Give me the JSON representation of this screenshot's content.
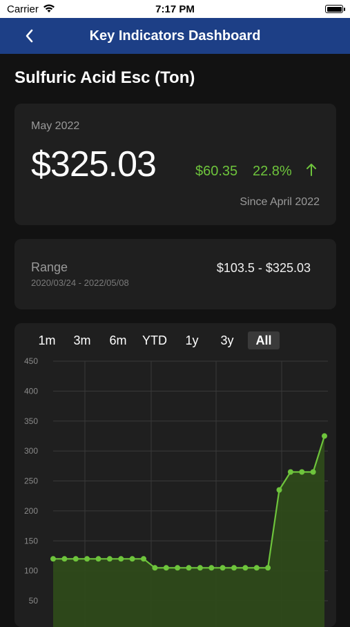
{
  "status_bar": {
    "carrier": "Carrier",
    "time": "7:17 PM"
  },
  "nav": {
    "title": "Key Indicators Dashboard"
  },
  "page": {
    "title": "Sulfuric Acid Esc (Ton)"
  },
  "price": {
    "date": "May 2022",
    "value": "$325.03",
    "change": "$60.35",
    "percent": "22.8%",
    "since": "Since April 2022"
  },
  "range": {
    "label": "Range",
    "dates": "2020/03/24 - 2022/05/08",
    "value": "$103.5 - $325.03"
  },
  "tabs": [
    "1m",
    "3m",
    "6m",
    "YTD",
    "1y",
    "3y",
    "All"
  ],
  "active_tab": "All",
  "colors": {
    "accent_green": "#6ec43c",
    "nav_blue": "#1d3f86",
    "area_fill": "#2e4a1a"
  },
  "chart_data": {
    "type": "area",
    "y_ticks": [
      50,
      100,
      150,
      200,
      250,
      300,
      350,
      400,
      450
    ],
    "ylim": [
      50,
      450
    ],
    "grid": true,
    "values": [
      120,
      120,
      120,
      120,
      120,
      120,
      120,
      120,
      120,
      105,
      105,
      105,
      105,
      105,
      105,
      105,
      105,
      105,
      105,
      105,
      235,
      265,
      265,
      265,
      325.03
    ]
  }
}
